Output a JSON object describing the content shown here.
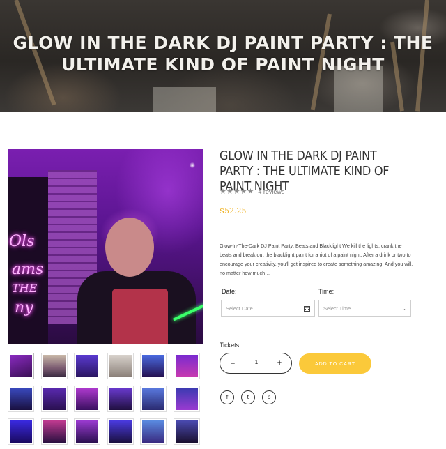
{
  "hero": {
    "title_line1": "GLOW IN THE DARK DJ PAINT PARTY : THE",
    "title_line2": "ULTIMATE KIND OF PAINT NIGHT"
  },
  "product": {
    "title": "GLOW IN THE DARK DJ PAINT PARTY : THE ULTIMATE KIND OF PAINT NIGHT",
    "rating": 5,
    "stars": "★★★★★",
    "reviews": "4 reviews",
    "price": "$52.25",
    "description": "Glow-In-The-Dark DJ Paint Party: Beats and Blacklight We kill the lights, crank the beats and break out the blacklight paint for a riot of a paint night. After a drink or two to encourage your creativity, you'll get inspired to create something amazing. And you will, no matter how much…"
  },
  "booking": {
    "date_label": "Date:",
    "date_placeholder": "Select Date...",
    "time_label": "Time:",
    "time_placeholder": "Select Time..."
  },
  "cart": {
    "tickets_label": "Tickets",
    "minus": "–",
    "quantity": "1",
    "plus": "+",
    "add_to_cart": "ADD TO CART"
  },
  "social": {
    "facebook": "f",
    "twitter": "t",
    "pinterest": "p"
  },
  "colors": {
    "accent": "#fbc93a",
    "price": "#f0b52b",
    "text": "#333333"
  }
}
